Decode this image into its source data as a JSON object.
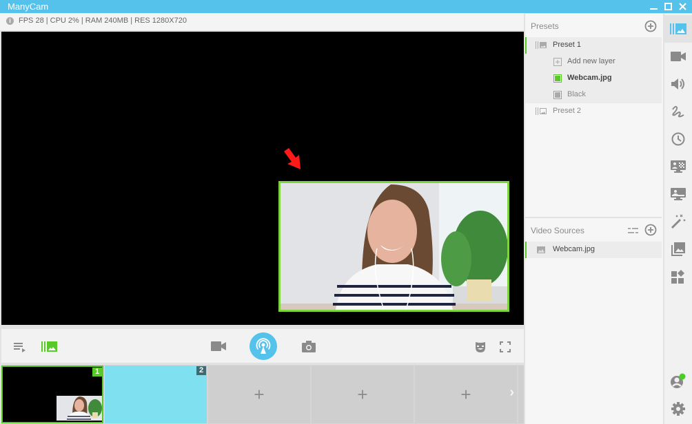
{
  "app": {
    "title": "ManyCam",
    "window_controls": {
      "minimize": "minimize",
      "maximize": "maximize",
      "close": "close"
    }
  },
  "status": {
    "info_icon": "i",
    "text": "FPS 28 | CPU 2% | RAM 240MB | RES 1280X720"
  },
  "colors": {
    "accent_blue": "#54c2eb",
    "accent_green": "#59c92a",
    "slot_two_bg": "#7fe0f0"
  },
  "controls": {
    "playlist": "playlist-icon",
    "presets_toggle": "presets-icon",
    "video": "video-camera-icon",
    "broadcast": "broadcast-icon",
    "snapshot": "camera-icon",
    "masks": "mask-icon",
    "fullscreen": "fullscreen-icon"
  },
  "thumbnails": [
    {
      "number": "1",
      "state": "active"
    },
    {
      "number": "2",
      "state": "filled"
    },
    {
      "number": "",
      "add_label": "+"
    },
    {
      "number": "",
      "add_label": "+"
    },
    {
      "number": "",
      "add_label": "+"
    }
  ],
  "thumbnails_next": "›",
  "presets": {
    "header": "Presets",
    "items": [
      {
        "label": "Preset 1",
        "layers": [
          {
            "label": "Add new layer",
            "type": "add"
          },
          {
            "label": "Webcam.jpg",
            "type": "active"
          },
          {
            "label": "Black",
            "type": "inactive"
          }
        ]
      },
      {
        "label": "Preset 2",
        "layers": []
      }
    ]
  },
  "video_sources": {
    "header": "Video Sources",
    "items": [
      {
        "label": "Webcam.jpg"
      }
    ]
  },
  "sidebar": {
    "items": [
      {
        "icon": "presets-icon",
        "active": true
      },
      {
        "icon": "video-camera-icon"
      },
      {
        "icon": "volume-icon"
      },
      {
        "icon": "drawing-icon"
      },
      {
        "icon": "clock-icon"
      },
      {
        "icon": "chroma-key-icon"
      },
      {
        "icon": "lower-thirds-icon"
      },
      {
        "icon": "effects-wand-icon"
      },
      {
        "icon": "image-gallery-icon"
      },
      {
        "icon": "widgets-icon"
      }
    ],
    "bottom": [
      {
        "icon": "account-icon",
        "online": true
      },
      {
        "icon": "settings-gear-icon"
      }
    ]
  }
}
